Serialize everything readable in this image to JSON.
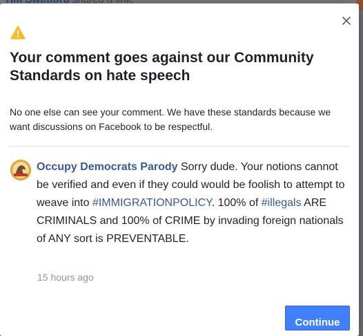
{
  "background": {
    "shared_link_author": "Tim Swinford",
    "shared_link_text": "shared a link."
  },
  "dialog": {
    "title": "Your comment goes against our Community Standards on hate speech",
    "subtitle": "No one else can see your comment. We have these standards because we want discussions on Facebook to be respectful.",
    "close_icon": "close-icon",
    "warning_icon": "warning-icon",
    "accent_color": "#4080ff",
    "warning_color": "#f7b928"
  },
  "comment": {
    "author": "Occupy Democrats Parody",
    "text_1": " Sorry dude. Your notions cannot be verified and even if they could would be foolish to attempt to weave into ",
    "hashtag_1": "#IMMIGRATIONPOLICY",
    "text_2": ". 100% of ",
    "hashtag_2": "#illegals",
    "text_3": " ARE CRIMINALS and 100% of CRIME by invading foreign nationals of ANY sort is PREVENTABLE.",
    "timestamp": "15 hours ago"
  },
  "actions": {
    "continue_label": "Continue"
  }
}
